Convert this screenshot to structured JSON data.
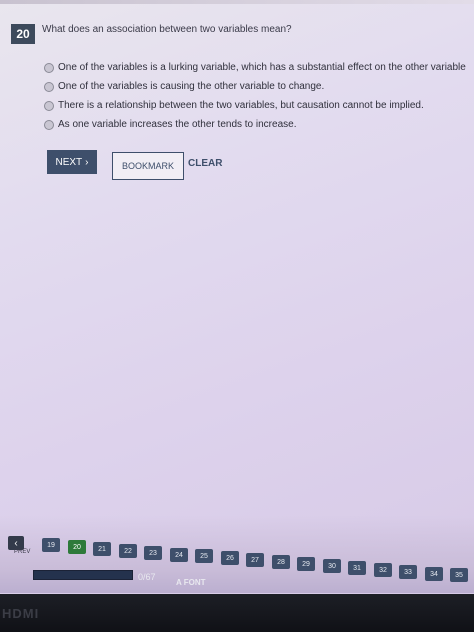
{
  "question": {
    "number": "20",
    "text": "What does an association between two variables mean?"
  },
  "options": [
    {
      "label": "One of the variables is a lurking variable, which has a substantial effect on the other variable"
    },
    {
      "label": "One of the variables is causing the other variable to change."
    },
    {
      "label": "There is a relationship between the two variables, but causation cannot be implied."
    },
    {
      "label": "As one variable increases the other tends to increase."
    }
  ],
  "actions": {
    "next_label": "NEXT",
    "next_icon": "›",
    "bookmark_label": "BOOKMARK",
    "clear_label": "CLEAR"
  },
  "navigation": {
    "prev_label": "PREV",
    "prev_icon": "‹",
    "current_page": "20",
    "pages": [
      "19",
      "20",
      "21",
      "22",
      "23",
      "24",
      "25",
      "26",
      "27",
      "28",
      "29",
      "30",
      "31",
      "32",
      "33",
      "34",
      "35"
    ]
  },
  "progress": {
    "text": "0/67",
    "fraction": 0.0,
    "bar_label": "0%"
  },
  "font_button": {
    "icon": "A",
    "label": "FONT"
  },
  "bezel": {
    "text": "HDMI"
  },
  "colors": {
    "primary": "#3e4f6b",
    "current_page": "#2e7a3a",
    "progress_fill": "#3a6ad0"
  }
}
